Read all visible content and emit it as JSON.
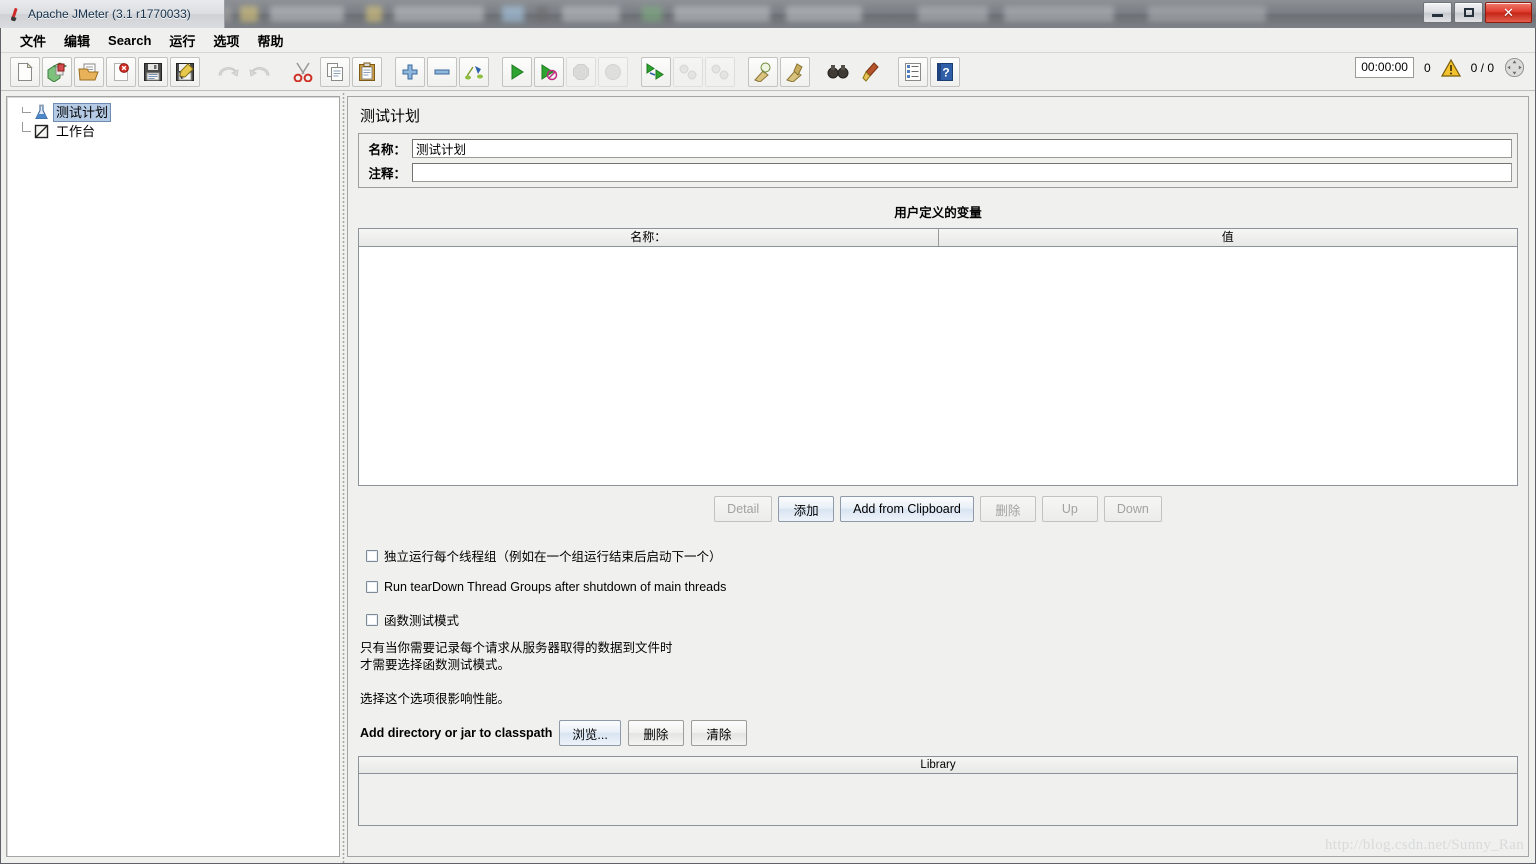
{
  "window": {
    "title": "Apache JMeter (3.1 r1770033)",
    "logo_icon": "jmeter-flask-icon",
    "minimize_label": "–",
    "restore_label": "❐",
    "close_label": "✕"
  },
  "menubar": {
    "items": [
      {
        "label": "文件",
        "name": "menu-file"
      },
      {
        "label": "编辑",
        "name": "menu-edit"
      },
      {
        "label": "Search",
        "name": "menu-search"
      },
      {
        "label": "运行",
        "name": "menu-run"
      },
      {
        "label": "选项",
        "name": "menu-options"
      },
      {
        "label": "帮助",
        "name": "menu-help"
      }
    ]
  },
  "toolbar": {
    "buttons": [
      {
        "icon": "new-document-icon",
        "enabled": true
      },
      {
        "icon": "templates-icon",
        "enabled": true
      },
      {
        "icon": "open-folder-icon",
        "enabled": true
      },
      {
        "icon": "close-document-icon",
        "enabled": true
      },
      {
        "icon": "save-icon",
        "enabled": true
      },
      {
        "icon": "save-as-icon",
        "enabled": true
      },
      {
        "icon": "undo-icon",
        "enabled": false
      },
      {
        "icon": "redo-icon",
        "enabled": false
      },
      {
        "icon": "cut-icon",
        "enabled": true
      },
      {
        "icon": "copy-icon",
        "enabled": true
      },
      {
        "icon": "paste-icon",
        "enabled": true
      },
      {
        "icon": "expand-all-icon",
        "enabled": true
      },
      {
        "icon": "collapse-all-icon",
        "enabled": true
      },
      {
        "icon": "toggle-icon",
        "enabled": true
      },
      {
        "icon": "start-icon",
        "enabled": true
      },
      {
        "icon": "start-no-pauses-icon",
        "enabled": true
      },
      {
        "icon": "stop-icon",
        "enabled": false
      },
      {
        "icon": "shutdown-icon",
        "enabled": false
      },
      {
        "icon": "remote-start-all-icon",
        "enabled": true
      },
      {
        "icon": "remote-stop-all-icon",
        "enabled": false
      },
      {
        "icon": "remote-shutdown-all-icon",
        "enabled": false
      },
      {
        "icon": "clear-icon",
        "enabled": true
      },
      {
        "icon": "clear-all-icon",
        "enabled": true
      },
      {
        "icon": "search-binoculars-icon",
        "enabled": true
      },
      {
        "icon": "reset-search-icon",
        "enabled": true
      },
      {
        "icon": "function-helper-icon",
        "enabled": true
      },
      {
        "icon": "help-icon",
        "enabled": true
      }
    ],
    "status": {
      "elapsed_time": "00:00:00",
      "warning_count": "0",
      "warning_icon": "warning-triangle-icon",
      "threads": "0 / 0",
      "connection_icon": "connection-status-icon"
    }
  },
  "tree": {
    "nodes": [
      {
        "label": "测试计划",
        "icon": "test-plan-icon",
        "selected": true
      },
      {
        "label": "工作台",
        "icon": "workbench-icon",
        "selected": false
      }
    ]
  },
  "panel": {
    "title": "测试计划",
    "fields": {
      "name_label": "名称：",
      "name_value": "测试计划",
      "comment_label": "注释：",
      "comment_value": ""
    },
    "variables": {
      "section_title": "用户定义的变量",
      "columns": [
        "名称：",
        "值"
      ],
      "rows": []
    },
    "variable_buttons": [
      {
        "label": "Detail",
        "name": "detail-button",
        "enabled": false,
        "primary": false
      },
      {
        "label": "添加",
        "name": "add-button",
        "enabled": true,
        "primary": true
      },
      {
        "label": "Add from Clipboard",
        "name": "add-from-clipboard-button",
        "enabled": true,
        "primary": true
      },
      {
        "label": "删除",
        "name": "delete-button",
        "enabled": false,
        "primary": false
      },
      {
        "label": "Up",
        "name": "up-button",
        "enabled": false,
        "primary": false
      },
      {
        "label": "Down",
        "name": "down-button",
        "enabled": false,
        "primary": false
      }
    ],
    "checkboxes": [
      {
        "label": "独立运行每个线程组（例如在一个组运行结束后启动下一个）",
        "name": "serialize-thread-groups-checkbox",
        "checked": false
      },
      {
        "label": "Run tearDown Thread Groups after shutdown of main threads",
        "name": "run-teardown-checkbox",
        "checked": false
      },
      {
        "label": "函数测试模式",
        "name": "functional-test-mode-checkbox",
        "checked": false
      }
    ],
    "help_lines": [
      "只有当你需要记录每个请求从服务器取得的数据到文件时",
      "才需要选择函数测试模式。",
      "",
      "选择这个选项很影响性能。"
    ],
    "classpath": {
      "label": "Add directory or jar to classpath",
      "buttons": [
        {
          "label": "浏览...",
          "name": "browse-button"
        },
        {
          "label": "删除",
          "name": "classpath-delete-button"
        },
        {
          "label": "清除",
          "name": "classpath-clear-button"
        }
      ]
    },
    "library": {
      "column": "Library",
      "rows": []
    }
  },
  "watermark": "http://blog.csdn.net/Sunny_Ran"
}
